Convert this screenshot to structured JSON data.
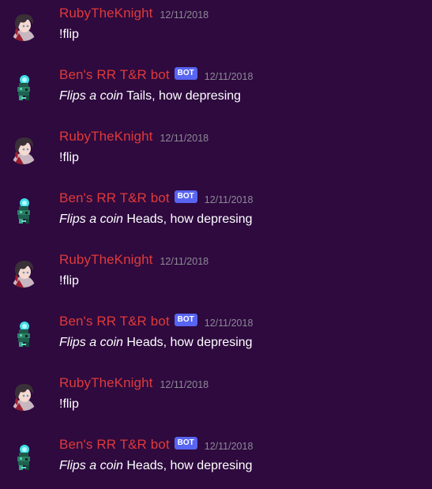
{
  "colors": {
    "background": "#2e0a3f",
    "username": "#e03a3a",
    "bot_tag": "#5865f2",
    "timestamp": "#8e8a96",
    "message_text": "#ffffff"
  },
  "messages": [
    {
      "author": "RubyTheKnight",
      "is_bot": false,
      "bot_tag": "",
      "timestamp": "12/11/2018",
      "italic": "",
      "text": "!flip",
      "avatar_icon": "ruby-avatar-icon"
    },
    {
      "author": "Ben's RR T&R bot",
      "is_bot": true,
      "bot_tag": "BOT",
      "timestamp": "12/11/2018",
      "italic": "Flips a coin",
      "text": " Tails, how depresing",
      "avatar_icon": "bot-avatar-icon"
    },
    {
      "author": "RubyTheKnight",
      "is_bot": false,
      "bot_tag": "",
      "timestamp": "12/11/2018",
      "italic": "",
      "text": "!flip",
      "avatar_icon": "ruby-avatar-icon"
    },
    {
      "author": "Ben's RR T&R bot",
      "is_bot": true,
      "bot_tag": "BOT",
      "timestamp": "12/11/2018",
      "italic": "Flips a coin",
      "text": " Heads, how depresing",
      "avatar_icon": "bot-avatar-icon"
    },
    {
      "author": "RubyTheKnight",
      "is_bot": false,
      "bot_tag": "",
      "timestamp": "12/11/2018",
      "italic": "",
      "text": "!flip",
      "avatar_icon": "ruby-avatar-icon"
    },
    {
      "author": "Ben's RR T&R bot",
      "is_bot": true,
      "bot_tag": "BOT",
      "timestamp": "12/11/2018",
      "italic": "Flips a coin",
      "text": " Heads, how depresing",
      "avatar_icon": "bot-avatar-icon"
    },
    {
      "author": "RubyTheKnight",
      "is_bot": false,
      "bot_tag": "",
      "timestamp": "12/11/2018",
      "italic": "",
      "text": "!flip",
      "avatar_icon": "ruby-avatar-icon"
    },
    {
      "author": "Ben's RR T&R bot",
      "is_bot": true,
      "bot_tag": "BOT",
      "timestamp": "12/11/2018",
      "italic": "Flips a coin",
      "text": " Heads, how depresing",
      "avatar_icon": "bot-avatar-icon"
    }
  ]
}
